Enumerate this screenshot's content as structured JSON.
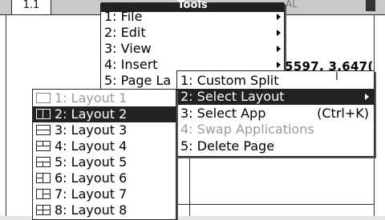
{
  "tabs": {
    "active_label": "1.1",
    "other_label": "AL"
  },
  "tools_menu": {
    "title": "Tools",
    "items": [
      {
        "label": "1: File"
      },
      {
        "label": "2: Edit"
      },
      {
        "label": "3: View"
      },
      {
        "label": "4: Insert"
      },
      {
        "label": "5: Page La"
      }
    ]
  },
  "page_layout_menu": {
    "items": [
      {
        "label": "1: Custom Split",
        "shortcut": ""
      },
      {
        "label": "2: Select Layout",
        "shortcut": ""
      },
      {
        "label": "3: Select App",
        "shortcut": "(Ctrl+K)"
      },
      {
        "label": "4: Swap Applications",
        "shortcut": ""
      },
      {
        "label": "5: Delete Page",
        "shortcut": ""
      }
    ]
  },
  "layout_menu": {
    "items": [
      {
        "label": "1: Layout 1",
        "icon": "layout-full-icon"
      },
      {
        "label": "2: Layout 2",
        "icon": "layout-vertical-split-icon"
      },
      {
        "label": "3: Layout 3",
        "icon": "layout-horizontal-split-icon"
      },
      {
        "label": "4: Layout 4",
        "icon": "layout-top-split-icon"
      },
      {
        "label": "5: Layout 5",
        "icon": "layout-bottom-split-icon"
      },
      {
        "label": "6: Layout 6",
        "icon": "layout-left-split-icon"
      },
      {
        "label": "7: Layout 7",
        "icon": "layout-right-split-icon"
      },
      {
        "label": "8: Layout 8",
        "icon": "layout-quad-icon"
      }
    ]
  },
  "graph": {
    "coordinate_text": "5597, 3.647("
  },
  "colors": {
    "menu_bg": "#ffffff",
    "selection_bg": "#222222",
    "disabled_text": "#9a9a9a",
    "tab_strip": "#c9c9c9"
  }
}
